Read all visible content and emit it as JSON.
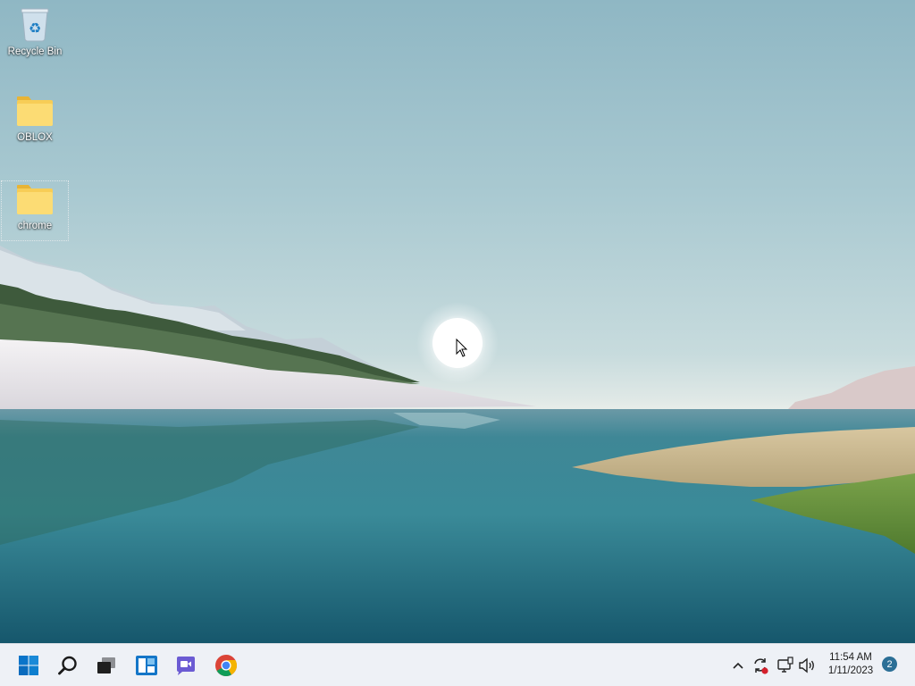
{
  "desktop": {
    "icons": [
      {
        "label": "Recycle Bin",
        "icon": "recycle-bin-icon"
      },
      {
        "label": "OBLOX",
        "icon": "folder-icon"
      },
      {
        "label": "chrome",
        "icon": "folder-icon",
        "selected": true
      }
    ]
  },
  "taskbar": {
    "apps": [
      {
        "name": "Start",
        "icon": "windows-start-icon"
      },
      {
        "name": "Search",
        "icon": "search-icon"
      },
      {
        "name": "Task View",
        "icon": "task-view-icon"
      },
      {
        "name": "Widgets",
        "icon": "widgets-icon"
      },
      {
        "name": "Chat",
        "icon": "teams-chat-icon"
      },
      {
        "name": "Google Chrome",
        "icon": "chrome-icon"
      }
    ],
    "tray": {
      "icons": [
        "chevron-up-icon",
        "sync-alert-icon",
        "network-icon",
        "volume-icon"
      ],
      "time": "11:54 AM",
      "date": "1/11/2023",
      "notification_count": "2"
    }
  },
  "colors": {
    "taskbar_bg": "#eef1f6",
    "accent": "#0a74c9",
    "badge": "#2b6f96"
  }
}
